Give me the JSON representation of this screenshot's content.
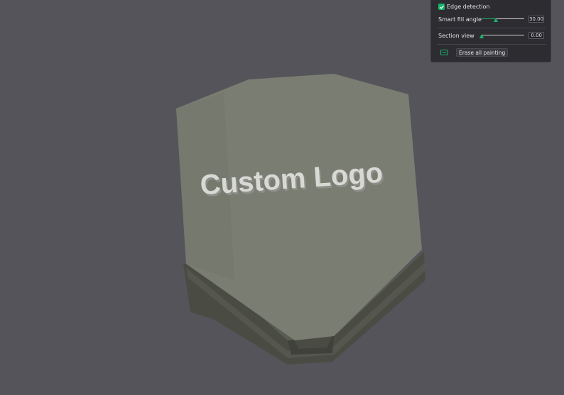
{
  "paint_panel": {
    "edge_detection": {
      "label": "Edge detection",
      "checked": true
    },
    "smart_fill_angle": {
      "label": "Smart fill angle",
      "value": "30.00",
      "level": 0.33
    },
    "section_view": {
      "label": "Section view",
      "value": "0.00",
      "level": 0.0
    },
    "erase_button": {
      "label": "Erase all painting",
      "icon": "eraser-icon"
    }
  },
  "model": {
    "embossed_text": "Custom Logo"
  },
  "colors": {
    "background": "#55545a",
    "accent": "#19b36b",
    "model_top": "#7a7d72",
    "model_side": "#4a4c44",
    "embossed_text": "#d8d8d5"
  }
}
